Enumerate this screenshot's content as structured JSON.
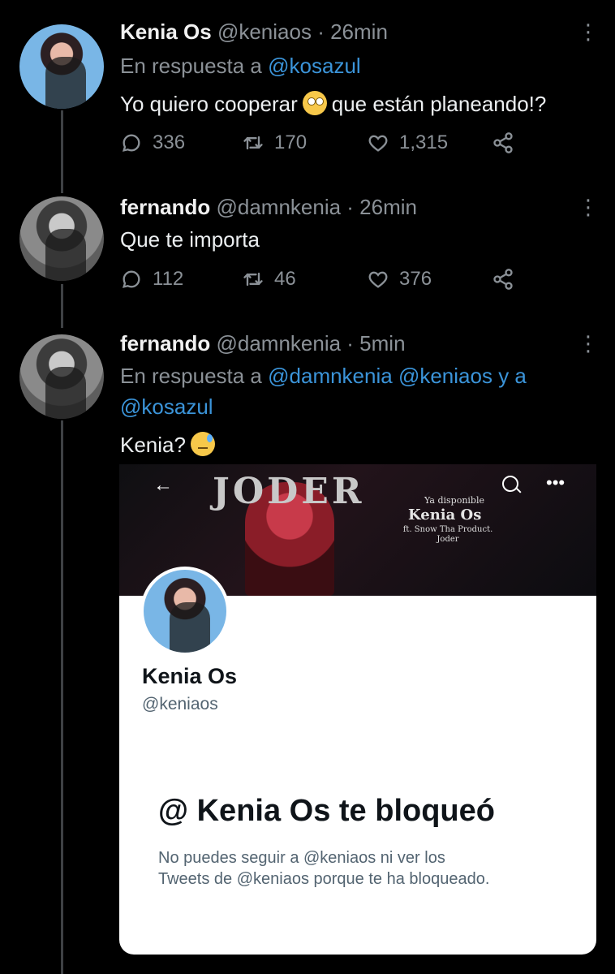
{
  "tweets": [
    {
      "name": "Kenia Os",
      "handle": "@keniaos",
      "time": "· 26min",
      "reply_prefix": "En respuesta a",
      "reply_to": "@kosazul",
      "text_before": "Yo quiero cooperar",
      "emoji": "face-with-rolling-eyes",
      "text_after": "que están planeando!?",
      "replies": "336",
      "retweets": "170",
      "likes": "1,315"
    },
    {
      "name": "fernando",
      "handle": "@damnkenia",
      "time": "· 26min",
      "text": "Que te importa",
      "replies": "112",
      "retweets": "46",
      "likes": "376"
    },
    {
      "name": "fernando",
      "handle": "@damnkenia",
      "time": "· 5min",
      "reply_prefix": "En respuesta a",
      "reply_to_1": "@damnkenia",
      "reply_to_2": "@keniaos",
      "reply_joiner": "y a",
      "reply_to_3": "@kosazul",
      "text": "Kenia?",
      "emoji": "downcast-face-with-sweat"
    }
  ],
  "attachment": {
    "banner": {
      "logo": "JODER",
      "line1": "Ya disponible",
      "line2": "Kenia Os",
      "line3": "ft. Snow Tha Product.\nJoder"
    },
    "profile": {
      "name": "Kenia Os",
      "handle": "@keniaos",
      "blocked_title": "@ Kenia Os te bloqueó",
      "blocked_desc": "No puedes seguir a @keniaos   ni ver los\nTweets de @keniaos   porque te ha bloqueado."
    }
  },
  "icons": {
    "reply": "reply-icon",
    "retweet": "retweet-icon",
    "like": "heart-icon",
    "share": "share-icon",
    "more": "more-vertical-icon"
  },
  "colors": {
    "background": "#000000",
    "link": "#3b94d9",
    "muted": "#8b9197",
    "text": "#e7e9ea"
  }
}
